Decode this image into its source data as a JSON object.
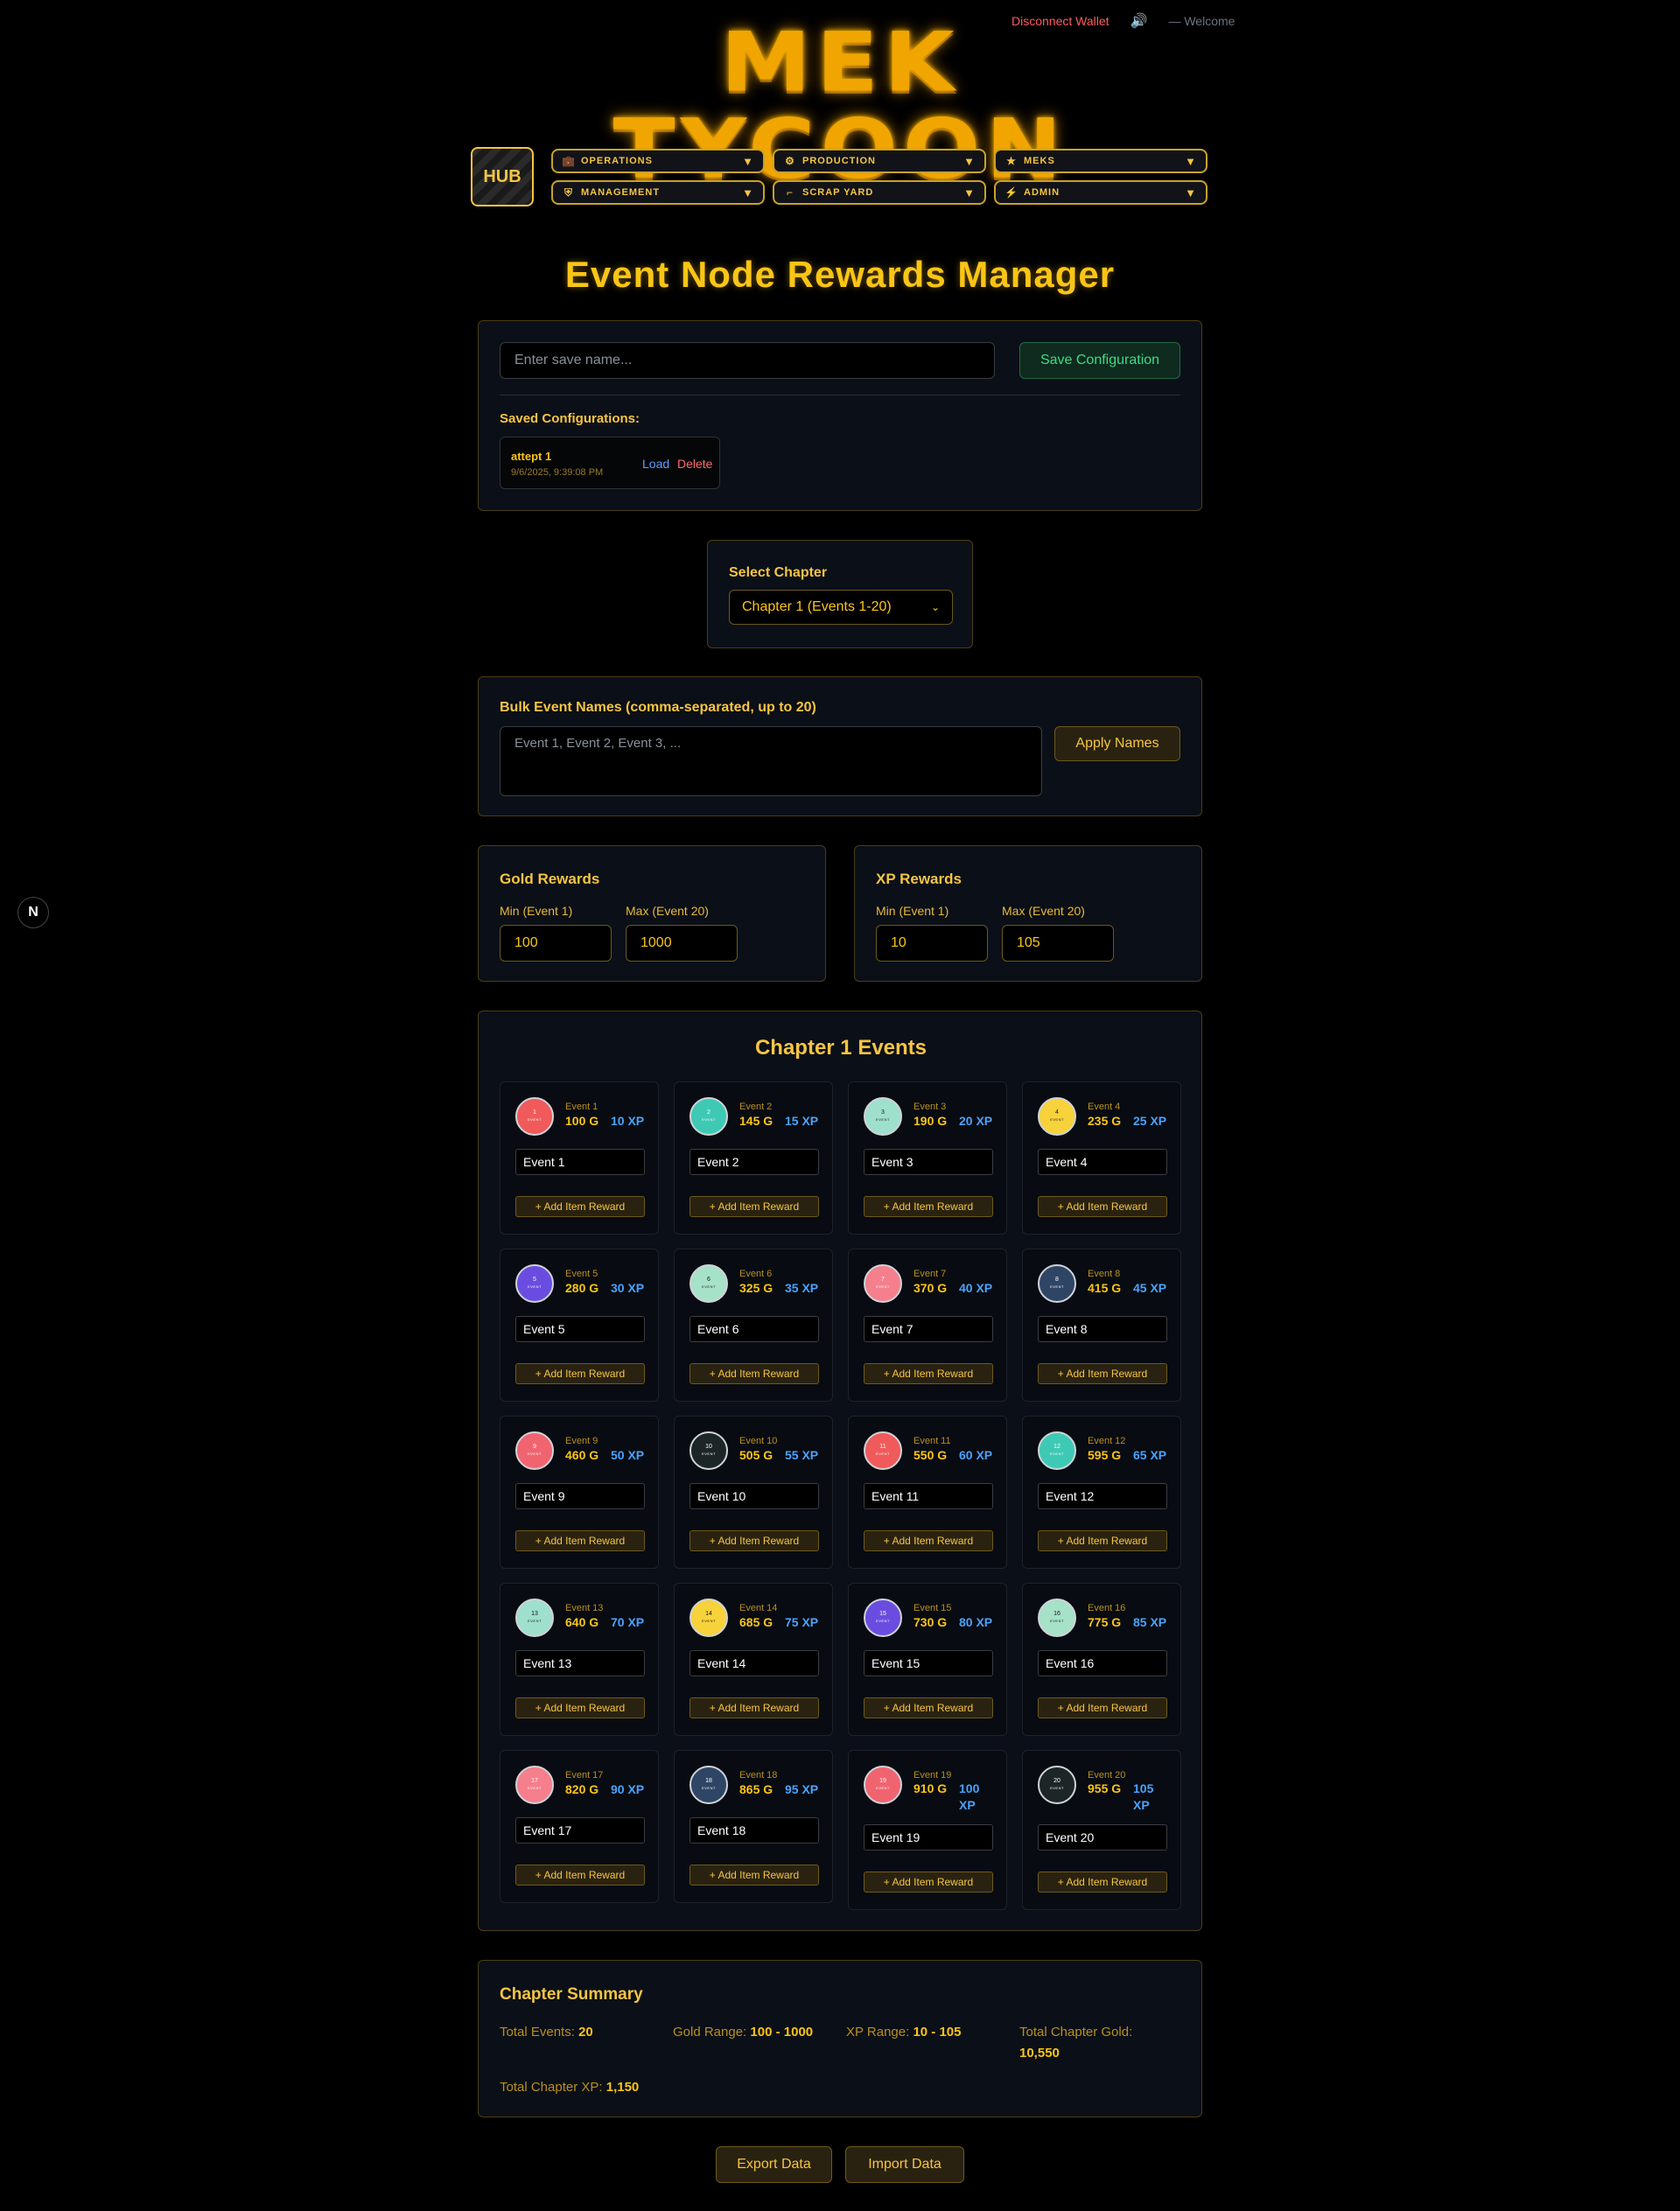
{
  "header": {
    "disconnect": "Disconnect Wallet",
    "welcome": "Welcome",
    "logo_text": "MEK TYCOON"
  },
  "nav": {
    "hub": "HUB",
    "items": [
      {
        "label": "OPERATIONS",
        "icon": "briefcase-icon"
      },
      {
        "label": "PRODUCTION",
        "icon": "gear-icon"
      },
      {
        "label": "MEKS",
        "icon": "star-icon"
      },
      {
        "label": "MANAGEMENT",
        "icon": "shield-icon"
      },
      {
        "label": "SCRAP YARD",
        "icon": "wrench-icon"
      },
      {
        "label": "ADMIN",
        "icon": "bolt-icon"
      }
    ]
  },
  "page_title": "Event Node Rewards Manager",
  "save": {
    "placeholder": "Enter save name...",
    "button": "Save Configuration",
    "saved_label": "Saved Configurations:",
    "items": [
      {
        "name": "attept 1",
        "date": "9/6/2025, 9:39:08 PM",
        "load": "Load",
        "delete": "Delete"
      }
    ]
  },
  "chapter": {
    "label": "Select Chapter",
    "selected": "Chapter 1 (Events 1-20)"
  },
  "bulk": {
    "label": "Bulk Event Names (comma-separated, up to 20)",
    "placeholder": "Event 1, Event 2, Event 3, ...",
    "button": "Apply Names"
  },
  "gold": {
    "title": "Gold Rewards",
    "min_label": "Min (Event 1)",
    "max_label": "Max (Event 20)",
    "min": "100",
    "max": "1000"
  },
  "xp": {
    "title": "XP Rewards",
    "min_label": "Min (Event 1)",
    "max_label": "Max (Event 20)",
    "min": "10",
    "max": "105"
  },
  "events": {
    "title": "Chapter 1 Events",
    "add_label": "+ Add Item Reward",
    "node_sub": "EVENT",
    "list": [
      {
        "num": "1",
        "title": "Event 1",
        "gold": "100 G",
        "xp": "10 XP",
        "name": "Event 1",
        "color": "#f05a5a"
      },
      {
        "num": "2",
        "title": "Event 2",
        "gold": "145 G",
        "xp": "15 XP",
        "name": "Event 2",
        "color": "#3ec9b5"
      },
      {
        "num": "3",
        "title": "Event 3",
        "gold": "190 G",
        "xp": "20 XP",
        "name": "Event 3",
        "color": "#9ee0cc"
      },
      {
        "num": "4",
        "title": "Event 4",
        "gold": "235 G",
        "xp": "25 XP",
        "name": "Event 4",
        "color": "#f7d23a"
      },
      {
        "num": "5",
        "title": "Event 5",
        "gold": "280 G",
        "xp": "30 XP",
        "name": "Event 5",
        "color": "#6a4de0"
      },
      {
        "num": "6",
        "title": "Event 6",
        "gold": "325 G",
        "xp": "35 XP",
        "name": "Event 6",
        "color": "#a6e2c8"
      },
      {
        "num": "7",
        "title": "Event 7",
        "gold": "370 G",
        "xp": "40 XP",
        "name": "Event 7",
        "color": "#f57f8c"
      },
      {
        "num": "8",
        "title": "Event 8",
        "gold": "415 G",
        "xp": "45 XP",
        "name": "Event 8",
        "color": "#2f4566"
      },
      {
        "num": "9",
        "title": "Event 9",
        "gold": "460 G",
        "xp": "50 XP",
        "name": "Event 9",
        "color": "#f06470"
      },
      {
        "num": "10",
        "title": "Event 10",
        "gold": "505 G",
        "xp": "55 XP",
        "name": "Event 10",
        "color": "#1c2626"
      },
      {
        "num": "11",
        "title": "Event 11",
        "gold": "550 G",
        "xp": "60 XP",
        "name": "Event 11",
        "color": "#f05a5a"
      },
      {
        "num": "12",
        "title": "Event 12",
        "gold": "595 G",
        "xp": "65 XP",
        "name": "Event 12",
        "color": "#3ec9b5"
      },
      {
        "num": "13",
        "title": "Event 13",
        "gold": "640 G",
        "xp": "70 XP",
        "name": "Event 13",
        "color": "#9ee0cc"
      },
      {
        "num": "14",
        "title": "Event 14",
        "gold": "685 G",
        "xp": "75 XP",
        "name": "Event 14",
        "color": "#f7d23a"
      },
      {
        "num": "15",
        "title": "Event 15",
        "gold": "730 G",
        "xp": "80 XP",
        "name": "Event 15",
        "color": "#6a4de0"
      },
      {
        "num": "16",
        "title": "Event 16",
        "gold": "775 G",
        "xp": "85 XP",
        "name": "Event 16",
        "color": "#a6e2c8"
      },
      {
        "num": "17",
        "title": "Event 17",
        "gold": "820 G",
        "xp": "90 XP",
        "name": "Event 17",
        "color": "#f57f8c"
      },
      {
        "num": "18",
        "title": "Event 18",
        "gold": "865 G",
        "xp": "95 XP",
        "name": "Event 18",
        "color": "#2f4566"
      },
      {
        "num": "19",
        "title": "Event 19",
        "gold": "910 G",
        "xp": "100 XP",
        "name": "Event 19",
        "color": "#f06470"
      },
      {
        "num": "20",
        "title": "Event 20",
        "gold": "955 G",
        "xp": "105 XP",
        "name": "Event 20",
        "color": "#1c2626"
      }
    ]
  },
  "summary": {
    "title": "Chapter Summary",
    "total_events_label": "Total Events:",
    "total_events": "20",
    "gold_range_label": "Gold Range:",
    "gold_range": "100 - 1000",
    "xp_range_label": "XP Range:",
    "xp_range": "10 - 105",
    "total_gold_label": "Total Chapter Gold:",
    "total_gold": "10,550",
    "total_xp_label": "Total Chapter XP:",
    "total_xp": "1,150"
  },
  "footer": {
    "export": "Export Data",
    "import": "Import Data"
  },
  "badge": "N"
}
